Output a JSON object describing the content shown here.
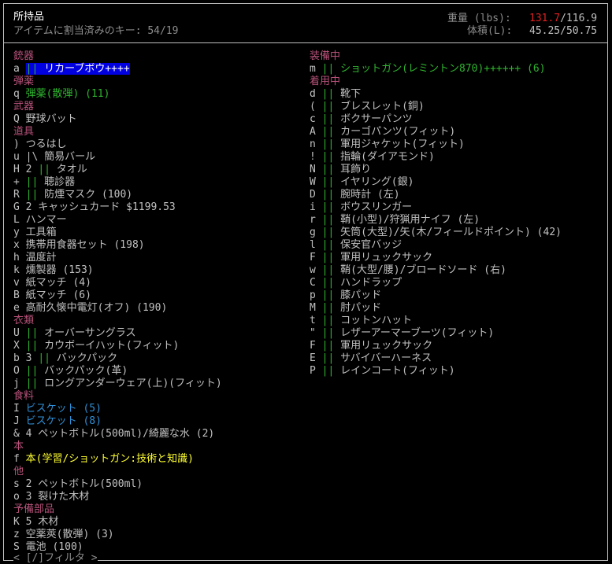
{
  "header": {
    "title": "所持品",
    "key_info": "アイテムに割当済みのキー: 54/19",
    "weight_label": "重量 (lbs):",
    "weight_current": "131.7",
    "weight_max": "/116.9",
    "volume_label": "体積(L):",
    "volume_value": "45.25/50.75"
  },
  "colors": {
    "category": "#b8527a",
    "green": "#2fb52f",
    "blue": "#2f8fd6",
    "yellow": "#ffff30",
    "overweight": "#e02020",
    "highlight": "#0000e0"
  },
  "left": [
    {
      "type": "cat",
      "text": "銃器"
    },
    {
      "type": "item",
      "key": "a",
      "sep": "||",
      "sep_color": "green",
      "name": "リカーブボウ++++",
      "color": "gray",
      "selected": true
    },
    {
      "type": "cat",
      "text": "弾薬"
    },
    {
      "type": "item",
      "key": "q",
      "sep": "",
      "name": "弾薬(散弾) (11)",
      "color": "green"
    },
    {
      "type": "cat",
      "text": "武器"
    },
    {
      "type": "item",
      "key": "Q",
      "sep": "",
      "name": "野球バット",
      "color": "gray"
    },
    {
      "type": "cat",
      "text": "道具"
    },
    {
      "type": "item",
      "key": ")",
      "sep": "",
      "name": "つるはし",
      "color": "gray"
    },
    {
      "type": "item",
      "key": "u",
      "sep": "|\\",
      "sep_color": "white",
      "name": "簡易バール",
      "color": "gray"
    },
    {
      "type": "item",
      "key": "H",
      "sep": "||",
      "sep_color": "green",
      "prefix": "2",
      "name": "タオル",
      "color": "gray"
    },
    {
      "type": "item",
      "key": "+",
      "sep": "||",
      "sep_color": "green",
      "name": "聴診器",
      "color": "gray"
    },
    {
      "type": "item",
      "key": "R",
      "sep": "||",
      "sep_color": "green",
      "name": "防煙マスク (100)",
      "color": "gray"
    },
    {
      "type": "item",
      "key": "G",
      "sep": "",
      "name": "2 キャッシュカード $1199.53",
      "color": "gray"
    },
    {
      "type": "item",
      "key": "L",
      "sep": "",
      "name": "ハンマー",
      "color": "gray"
    },
    {
      "type": "item",
      "key": "y",
      "sep": "",
      "name": "工具箱",
      "color": "gray"
    },
    {
      "type": "item",
      "key": "x",
      "sep": "",
      "name": "携帯用食器セット (198)",
      "color": "gray"
    },
    {
      "type": "item",
      "key": "h",
      "sep": "",
      "name": "温度計",
      "color": "gray"
    },
    {
      "type": "item",
      "key": "k",
      "sep": "",
      "name": "燻製器 (153)",
      "color": "gray"
    },
    {
      "type": "item",
      "key": "v",
      "sep": "",
      "name": "紙マッチ (4)",
      "color": "gray"
    },
    {
      "type": "item",
      "key": "B",
      "sep": "",
      "name": "紙マッチ (6)",
      "color": "gray"
    },
    {
      "type": "item",
      "key": "e",
      "sep": "",
      "name": "高耐久懐中電灯(オフ) (190)",
      "color": "gray"
    },
    {
      "type": "cat",
      "text": "衣類"
    },
    {
      "type": "item",
      "key": "U",
      "sep": "||",
      "sep_color": "green",
      "name": "オーバーサングラス",
      "color": "gray"
    },
    {
      "type": "item",
      "key": "X",
      "sep": "||",
      "sep_color": "green",
      "name": "カウボーイハット(フィット)",
      "color": "gray"
    },
    {
      "type": "item",
      "key": "b",
      "sep": "||",
      "sep_color": "green",
      "prefix": "3",
      "name": "バックパック",
      "color": "gray"
    },
    {
      "type": "item",
      "key": "O",
      "sep": "||",
      "sep_color": "green",
      "name": "バックパック(革)",
      "color": "gray"
    },
    {
      "type": "item",
      "key": "j",
      "sep": "||",
      "sep_color": "green",
      "name": "ロングアンダーウェア(上)(フィット)",
      "color": "gray"
    },
    {
      "type": "cat",
      "text": "食料"
    },
    {
      "type": "item",
      "key": "I",
      "sep": "",
      "name": "ビスケット (5)",
      "color": "blue"
    },
    {
      "type": "item",
      "key": "J",
      "sep": "",
      "name": "ビスケット (8)",
      "color": "blue"
    },
    {
      "type": "item",
      "key": "&",
      "sep": "",
      "name": "4 ペットボトル(500ml)/綺麗な水 (2)",
      "color": "gray"
    },
    {
      "type": "cat",
      "text": "本"
    },
    {
      "type": "item",
      "key": "f",
      "sep": "",
      "name": "本(学習/ショットガン:技術と知識)",
      "color": "yellow"
    },
    {
      "type": "cat",
      "text": "他"
    },
    {
      "type": "item",
      "key": "s",
      "sep": "",
      "name": "2 ペットボトル(500ml)",
      "color": "gray"
    },
    {
      "type": "item",
      "key": "o",
      "sep": "",
      "name": "3 裂けた木材",
      "color": "gray"
    },
    {
      "type": "cat",
      "text": "予備部品"
    },
    {
      "type": "item",
      "key": "K",
      "sep": "",
      "name": "5 木材",
      "color": "gray"
    },
    {
      "type": "item",
      "key": "z",
      "sep": "",
      "name": "空薬莢(散弾) (3)",
      "color": "gray"
    },
    {
      "type": "item",
      "key": "S",
      "sep": "",
      "name": "電池 (100)",
      "color": "gray"
    }
  ],
  "right": [
    {
      "type": "cat",
      "text": "装備中"
    },
    {
      "type": "item",
      "key": "m",
      "sep": "||",
      "sep_color": "green",
      "name": "ショットガン(レミントン870)++++++ (6)",
      "color": "green"
    },
    {
      "type": "cat",
      "text": "着用中"
    },
    {
      "type": "item",
      "key": "d",
      "sep": "||",
      "sep_color": "green",
      "name": "靴下",
      "color": "gray"
    },
    {
      "type": "item",
      "key": "(",
      "sep": "||",
      "sep_color": "green",
      "name": "ブレスレット(銅)",
      "color": "gray"
    },
    {
      "type": "item",
      "key": "c",
      "sep": "||",
      "sep_color": "green",
      "name": "ボクサーパンツ",
      "color": "gray"
    },
    {
      "type": "item",
      "key": "A",
      "sep": "||",
      "sep_color": "green",
      "name": "カーゴパンツ(フィット)",
      "color": "gray"
    },
    {
      "type": "item",
      "key": "n",
      "sep": "||",
      "sep_color": "green",
      "name": "軍用ジャケット(フィット)",
      "color": "gray"
    },
    {
      "type": "item",
      "key": "!",
      "sep": "||",
      "sep_color": "green",
      "name": "指輪(ダイアモンド)",
      "color": "gray"
    },
    {
      "type": "item",
      "key": "N",
      "sep": "||",
      "sep_color": "green",
      "name": "耳飾り",
      "color": "gray"
    },
    {
      "type": "item",
      "key": "W",
      "sep": "||",
      "sep_color": "green",
      "name": "イヤリング(銀)",
      "color": "gray"
    },
    {
      "type": "item",
      "key": "D",
      "sep": "||",
      "sep_color": "green",
      "name": "腕時計 (左)",
      "color": "gray"
    },
    {
      "type": "item",
      "key": "i",
      "sep": "||",
      "sep_color": "green",
      "name": "ボウスリンガー",
      "color": "gray"
    },
    {
      "type": "item",
      "key": "r",
      "sep": "||",
      "sep_color": "green",
      "name": "鞘(小型)/狩猟用ナイフ (左)",
      "color": "gray"
    },
    {
      "type": "item",
      "key": "g",
      "sep": "||",
      "sep_color": "green",
      "name": "矢筒(大型)/矢(木/フィールドポイント) (42)",
      "color": "gray"
    },
    {
      "type": "item",
      "key": "l",
      "sep": "||",
      "sep_color": "green",
      "name": "保安官バッジ",
      "color": "gray"
    },
    {
      "type": "item",
      "key": "F",
      "sep": "||",
      "sep_color": "green",
      "name": "軍用リュックサック",
      "color": "gray"
    },
    {
      "type": "item",
      "key": "w",
      "sep": "||",
      "sep_color": "green",
      "name": "鞘(大型/腰)/ブロードソード (右)",
      "color": "gray"
    },
    {
      "type": "item",
      "key": "C",
      "sep": "||",
      "sep_color": "green",
      "name": "ハンドラップ",
      "color": "gray"
    },
    {
      "type": "item",
      "key": "p",
      "sep": "||",
      "sep_color": "green",
      "name": "膝パッド",
      "color": "gray"
    },
    {
      "type": "item",
      "key": "M",
      "sep": "||",
      "sep_color": "green",
      "name": "肘パッド",
      "color": "gray"
    },
    {
      "type": "item",
      "key": "t",
      "sep": "||",
      "sep_color": "green",
      "name": "コットンハット",
      "color": "gray"
    },
    {
      "type": "item",
      "key": "\"",
      "sep": "||",
      "sep_color": "green",
      "name": "レザーアーマーブーツ(フィット)",
      "color": "gray"
    },
    {
      "type": "item",
      "key": "F",
      "sep": "||",
      "sep_color": "green",
      "name": "軍用リュックサック",
      "color": "gray"
    },
    {
      "type": "item",
      "key": "E",
      "sep": "||",
      "sep_color": "green",
      "name": "サバイバーハーネス",
      "color": "gray"
    },
    {
      "type": "item",
      "key": "P",
      "sep": "||",
      "sep_color": "green",
      "name": "レインコート(フィット)",
      "color": "gray"
    }
  ],
  "footer": {
    "filter_hint": "< [/]フィルタ >"
  }
}
